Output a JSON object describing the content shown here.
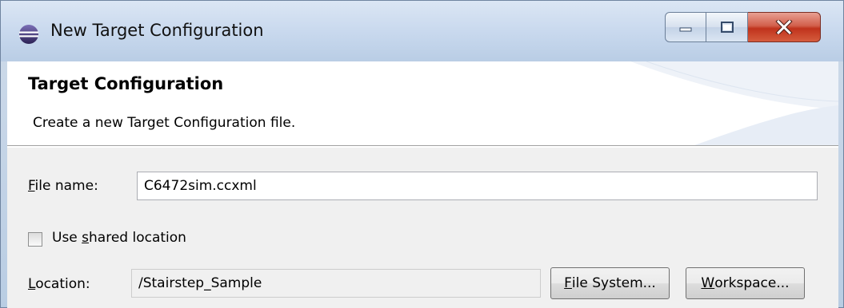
{
  "window": {
    "title": "New Target Configuration",
    "minimize_icon": "minimize-icon",
    "maximize_icon": "maximize-icon",
    "close_icon": "close-icon"
  },
  "header": {
    "title": "Target Configuration",
    "description": "Create a new Target Configuration file."
  },
  "form": {
    "file_name": {
      "label_mnemonic": "F",
      "label_rest": "ile name:",
      "value": "C6472sim.ccxml"
    },
    "shared_location": {
      "label_before": "Use ",
      "label_mnemonic": "s",
      "label_after": "hared location",
      "checked": false
    },
    "location": {
      "label_mnemonic": "L",
      "label_rest": "ocation:",
      "value": "/Stairstep_Sample"
    },
    "file_system_button": {
      "label_mnemonic": "F",
      "label_rest": "ile System..."
    },
    "workspace_button": {
      "label_mnemonic": "W",
      "label_rest": "orkspace..."
    }
  },
  "colors": {
    "titlebar": "#c9d9ee",
    "close_button": "#c0331c",
    "dialog_bg": "#f0f0f0"
  }
}
